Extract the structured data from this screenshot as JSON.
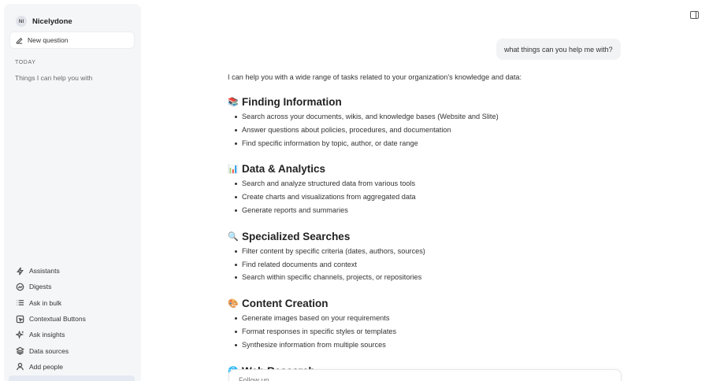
{
  "sidebar": {
    "workspace": {
      "initials": "NI",
      "name": "Nicelydone"
    },
    "new_question_label": "New question",
    "history_section_label": "TODAY",
    "history": [
      {
        "label": "Things I can help you with"
      }
    ],
    "nav": [
      {
        "label": "Assistants",
        "icon": "lightning-icon"
      },
      {
        "label": "Digests",
        "icon": "digest-icon"
      },
      {
        "label": "Ask in bulk",
        "icon": "list-icon"
      },
      {
        "label": "Contextual Buttons",
        "icon": "contextual-button-icon"
      },
      {
        "label": "Ask insights",
        "icon": "sparkle-icon"
      },
      {
        "label": "Data sources",
        "icon": "layers-icon"
      },
      {
        "label": "Add people",
        "icon": "person-icon"
      }
    ]
  },
  "conversation": {
    "user_message": "what things can you help me with?",
    "answer": {
      "intro": "I can help you with a wide range of tasks related to your organization's knowledge and data:",
      "sections": [
        {
          "emoji": "📚",
          "title": "Finding Information",
          "items": [
            "Search across your documents, wikis, and knowledge bases (Website and Slite)",
            "Answer questions about policies, procedures, and documentation",
            "Find specific information by topic, author, or date range"
          ]
        },
        {
          "emoji": "📊",
          "title": "Data & Analytics",
          "items": [
            "Search and analyze structured data from various tools",
            "Create charts and visualizations from aggregated data",
            "Generate reports and summaries"
          ]
        },
        {
          "emoji": "🔍",
          "title": "Specialized Searches",
          "items": [
            "Filter content by specific criteria (dates, authors, sources)",
            "Find related documents and context",
            "Search within specific channels, projects, or repositories"
          ]
        },
        {
          "emoji": "🎨",
          "title": "Content Creation",
          "items": [
            "Generate images based on your requirements",
            "Format responses in specific styles or templates",
            "Synthesize information from multiple sources"
          ]
        },
        {
          "emoji": "🌐",
          "title": "Web Research",
          "items": []
        }
      ]
    }
  },
  "composer": {
    "placeholder": "Follow up..."
  }
}
